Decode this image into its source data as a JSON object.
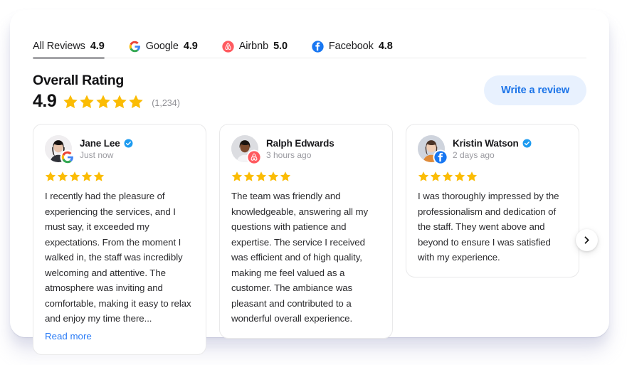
{
  "tabs": [
    {
      "label": "All Reviews",
      "score": "4.9",
      "icon": "none",
      "active": true
    },
    {
      "label": "Google",
      "score": "4.9",
      "icon": "google-icon",
      "active": false
    },
    {
      "label": "Airbnb",
      "score": "5.0",
      "icon": "airbnb-icon",
      "active": false
    },
    {
      "label": "Facebook",
      "score": "4.8",
      "icon": "facebook-icon",
      "active": false
    }
  ],
  "header": {
    "title": "Overall Rating",
    "rating": "4.9",
    "stars": 5,
    "count": "(1,234)",
    "write_review_label": "Write a review"
  },
  "reviews": [
    {
      "name": "Jane Lee",
      "verified": true,
      "time": "Just now",
      "source": "google-icon",
      "stars": 5,
      "text": "I recently had the pleasure of experiencing the services, and I must say, it exceeded my expectations. From the moment I walked in, the staff was incredibly welcoming and attentive. The atmosphere was inviting and comfortable, making it easy to relax and enjoy my time there...",
      "read_more_label": "Read more"
    },
    {
      "name": "Ralph Edwards",
      "verified": false,
      "time": "3 hours ago",
      "source": "airbnb-icon",
      "stars": 5,
      "text": "The team was friendly and knowledgeable, answering all my questions with patience and expertise. The service I received was efficient and of high quality, making me feel valued as a customer. The ambiance was pleasant and contributed to a wonderful overall experience.",
      "read_more_label": ""
    },
    {
      "name": "Kristin Watson",
      "verified": true,
      "time": "2 days ago",
      "source": "facebook-icon",
      "stars": 5,
      "text": "I was thoroughly impressed by the professionalism and dedication of the staff. They went above and beyond to ensure I was satisfied with my experience.",
      "read_more_label": ""
    }
  ],
  "carousel": {
    "next_label": "next-slide"
  },
  "colors": {
    "star": "#FBBC04",
    "link": "#2b7cf6",
    "button_bg": "#e8f1fe",
    "button_text": "#1a73e8",
    "verified": "#1d9bf0",
    "google_blue": "#4285F4",
    "airbnb": "#FF5A5F",
    "facebook": "#1877F2"
  }
}
